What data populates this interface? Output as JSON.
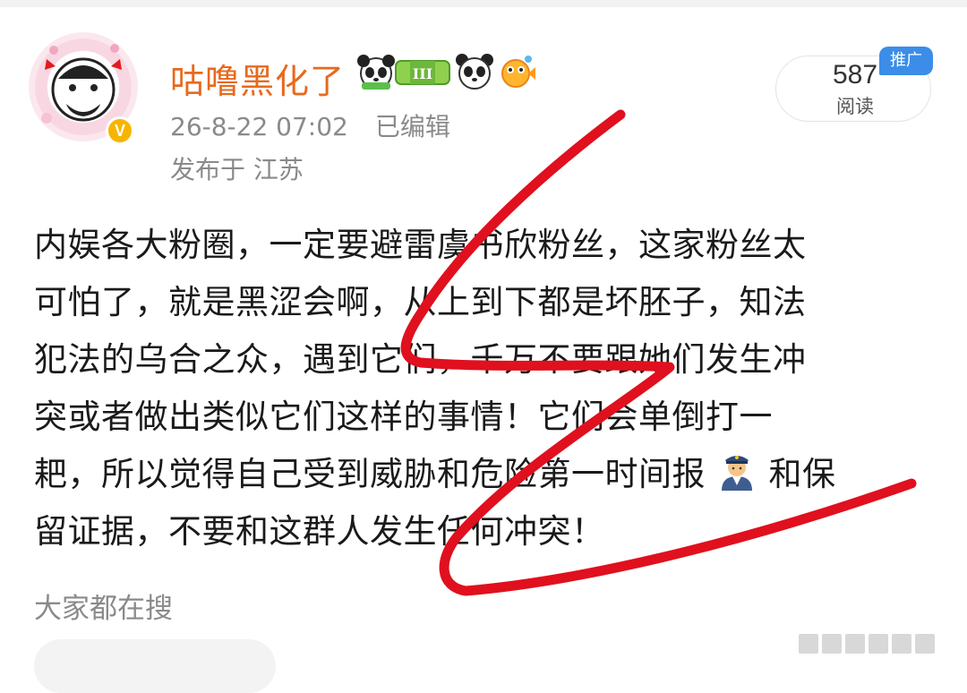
{
  "post": {
    "username": "咕噜黑化了",
    "time": "26-8-22 07:02",
    "edited": "已编辑",
    "location": "发布于 江苏",
    "verified_badge": "V",
    "read_count": "587",
    "read_label": "阅读",
    "promo_tag": "推广",
    "badge_icons": [
      "panda-badge-icon",
      "level-iii-badge-icon",
      "panda-face-icon",
      "fish-icon"
    ],
    "content_lines": [
      "内娱各大粉圈，一定要避雷虞书欣粉丝，这家粉丝太",
      "可怕了，就是黑涩会啊，从上到下都是坏胚子，知法",
      "犯法的乌合之众，遇到它们，千万不要跟她们发生冲",
      "突或者做出类似它们这样的事情！它们会单倒打一",
      "耙，所以觉得自己受到威胁和危险第一时间报",
      "和保",
      "留证据，不要和这群人发生任何冲突！"
    ],
    "emoji": "police-officer-icon"
  },
  "search": {
    "title": "大家都在搜"
  },
  "colors": {
    "username": "#e8691d",
    "meta": "#8a8a8a",
    "promo": "#3b8de8",
    "verified": "#f7b500",
    "annotation": "#e0101e"
  }
}
